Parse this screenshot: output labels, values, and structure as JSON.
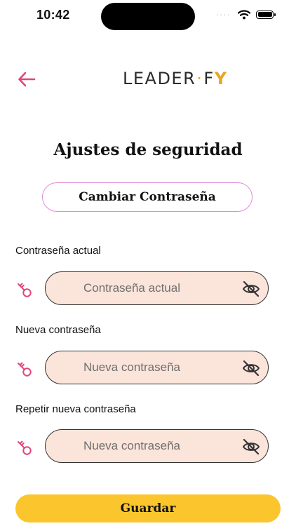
{
  "status_bar": {
    "time": "10:42"
  },
  "header": {
    "logo_text_left": "LEADER",
    "logo_dot": "·",
    "logo_text_right": "F",
    "logo_y": "Y"
  },
  "page": {
    "title": "Ajustes de seguridad",
    "tab_label": "Cambiar Contraseña"
  },
  "fields": [
    {
      "label": "Contraseña actual",
      "placeholder": "Contraseña actual",
      "value": ""
    },
    {
      "label": "Nueva contraseña",
      "placeholder": "Nueva contraseña",
      "value": ""
    },
    {
      "label": "Repetir nueva contraseña",
      "placeholder": "Nueva contraseña",
      "value": ""
    }
  ],
  "actions": {
    "save_label": "Guardar"
  },
  "colors": {
    "accent_pink": "#e0457b",
    "input_bg": "#fbe4da",
    "button_yellow": "#fbc62d",
    "tab_border": "#e48ad8",
    "logo_gold": "#e8a722"
  },
  "icons": {
    "back": "arrow-left-icon",
    "key": "key-icon",
    "eye": "eye-slash-icon",
    "wifi": "wifi-icon",
    "battery": "battery-icon"
  }
}
